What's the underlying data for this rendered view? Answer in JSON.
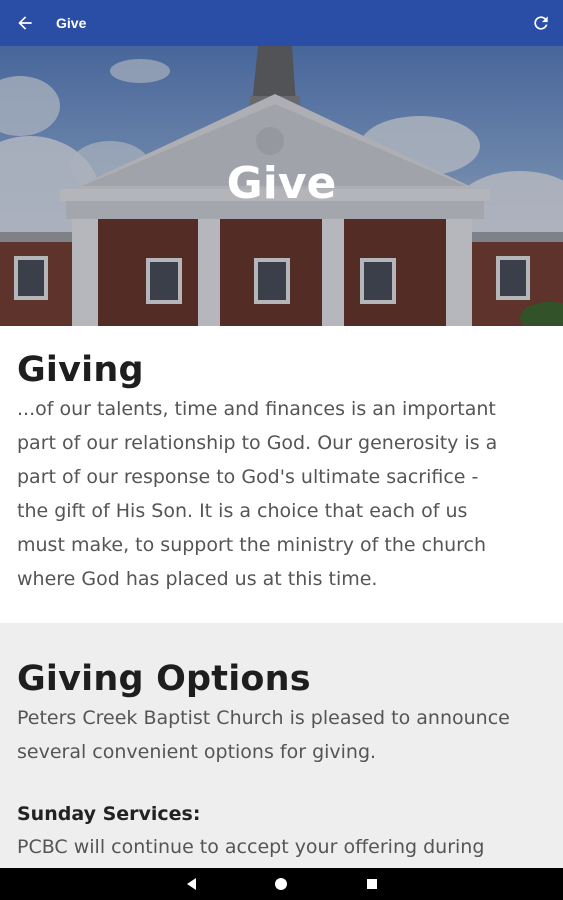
{
  "appbar": {
    "title": "Give",
    "back_icon": "arrow-left-icon",
    "refresh_icon": "refresh-icon",
    "color": "#2a4ea6"
  },
  "hero": {
    "title": "Give"
  },
  "giving": {
    "heading": "Giving",
    "lines": [
      "...of our talents, time and finances is an important",
      "part of our relationship to God. Our generosity is a",
      "part of our response to God's ultimate sacrifice -",
      "the gift of His Son. It is a choice that each of us",
      "must make, to support the ministry of the church",
      "where God has placed us at this time."
    ]
  },
  "options": {
    "heading": "Giving Options",
    "intro_lines": [
      "Peters Creek Baptist Church is pleased to announce",
      "several convenient options for giving."
    ],
    "sunday_heading": "Sunday Services:",
    "sunday_lines": [
      "PCBC will continue to accept your offering during"
    ]
  },
  "navbar": {
    "back_icon": "nav-back-icon",
    "home_icon": "nav-home-icon",
    "recents_icon": "nav-recents-icon"
  }
}
